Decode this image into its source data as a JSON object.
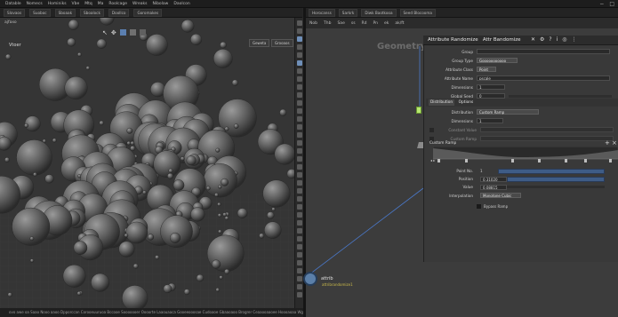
{
  "menu": {
    "items": [
      "Datable",
      "Nomecs",
      "Hominiks",
      "Vbe",
      "Mtq",
      "Ma",
      "Roolcage",
      "Wreaks",
      "Nibolaw",
      "Daolcon",
      "Ros",
      "Hooss",
      "Mmsoes"
    ]
  },
  "viewer_pane": {
    "tabs": [
      "Slovaos",
      "Suoboc",
      "Sboaak",
      "Sboalock",
      "Doollco",
      "Goromakes",
      "Sdoolcooroon",
      "Vidoolca"
    ],
    "path": "ajfaxo",
    "viewport_label": "Vtoer",
    "chips": [
      "Geweta",
      "Grooaos"
    ],
    "status_text": "ovo awe oa Saao Nooo aaoo Dpporccan Corooeuuruoa Bccooe Sooooooer Oooorte Laaouaaca Gooeeooosae Cudoaoe Gbaaoaoo Brogrer Ceaaooaaoee Hoooaoaa Wgrnwtdoo Joeanrcoo Poenoo"
  },
  "network_pane": {
    "tabs": [
      "Horocanss",
      "Sarkrk",
      "Diwk Baotkooa",
      "Seed Blocooma"
    ],
    "path_items": [
      "Nob",
      "Thb",
      "Sae",
      "ss",
      "Rd",
      "Pn",
      "ek",
      "ak/ft"
    ],
    "context_label": "Geometry",
    "panel": {
      "title": "Attribute Randomize",
      "subtitle": "Attr Bandomize",
      "rows": [
        {
          "label": "Group",
          "value": ""
        },
        {
          "label": "Group Type",
          "value": "Gooooooooooo"
        },
        {
          "label": "Attribute Class",
          "value": "Point"
        },
        {
          "label": "Attribute Name",
          "value": "pscale"
        },
        {
          "label": "Dimensions",
          "value": "1"
        },
        {
          "label": "Global Seed",
          "value": "0"
        }
      ],
      "section_tabs": [
        "Distribution",
        "Options"
      ],
      "dist_rows": [
        {
          "label": "Distribution",
          "value": "Custom Ramp"
        },
        {
          "label": "Dimensions",
          "value": "1"
        },
        {
          "label": "Constant Value",
          "value": ""
        },
        {
          "label": "Custom Ramp",
          "value": ""
        }
      ],
      "ramp_label": "Custom Ramp",
      "lower_rows": [
        {
          "label": "Point No.",
          "value": "1"
        },
        {
          "label": "Position",
          "value": "0.31020"
        },
        {
          "label": "Value",
          "value": "0.08815"
        },
        {
          "label": "Interpolation",
          "value": "Monotone Cubic"
        }
      ],
      "checkbox_label": "Bypass Ramp"
    },
    "node_name": "attrib",
    "node_subtitle": "attribrandomize1"
  }
}
